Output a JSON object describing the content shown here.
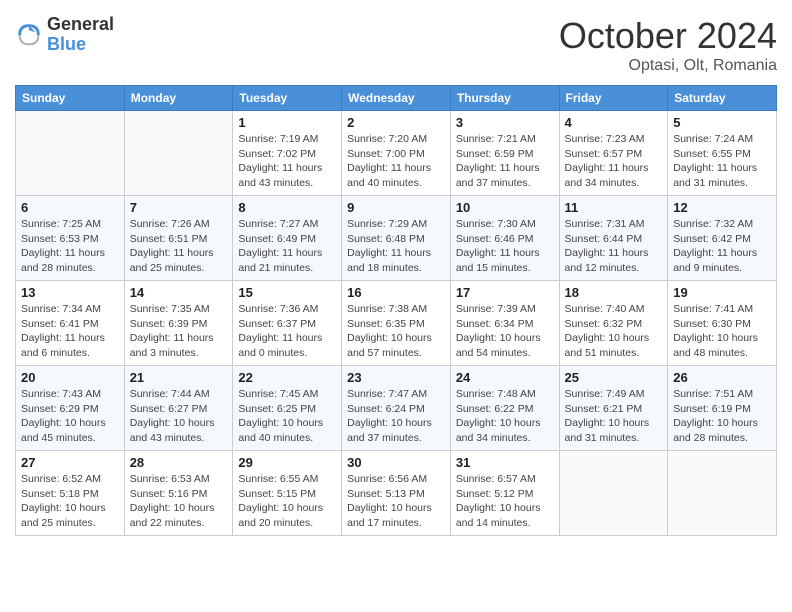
{
  "header": {
    "logo_line1": "General",
    "logo_line2": "Blue",
    "month": "October 2024",
    "location": "Optasi, Olt, Romania"
  },
  "weekdays": [
    "Sunday",
    "Monday",
    "Tuesday",
    "Wednesday",
    "Thursday",
    "Friday",
    "Saturday"
  ],
  "weeks": [
    [
      {
        "day": "",
        "empty": true
      },
      {
        "day": "",
        "empty": true
      },
      {
        "day": "1",
        "sunrise": "Sunrise: 7:19 AM",
        "sunset": "Sunset: 7:02 PM",
        "daylight": "Daylight: 11 hours and 43 minutes."
      },
      {
        "day": "2",
        "sunrise": "Sunrise: 7:20 AM",
        "sunset": "Sunset: 7:00 PM",
        "daylight": "Daylight: 11 hours and 40 minutes."
      },
      {
        "day": "3",
        "sunrise": "Sunrise: 7:21 AM",
        "sunset": "Sunset: 6:59 PM",
        "daylight": "Daylight: 11 hours and 37 minutes."
      },
      {
        "day": "4",
        "sunrise": "Sunrise: 7:23 AM",
        "sunset": "Sunset: 6:57 PM",
        "daylight": "Daylight: 11 hours and 34 minutes."
      },
      {
        "day": "5",
        "sunrise": "Sunrise: 7:24 AM",
        "sunset": "Sunset: 6:55 PM",
        "daylight": "Daylight: 11 hours and 31 minutes."
      }
    ],
    [
      {
        "day": "6",
        "sunrise": "Sunrise: 7:25 AM",
        "sunset": "Sunset: 6:53 PM",
        "daylight": "Daylight: 11 hours and 28 minutes."
      },
      {
        "day": "7",
        "sunrise": "Sunrise: 7:26 AM",
        "sunset": "Sunset: 6:51 PM",
        "daylight": "Daylight: 11 hours and 25 minutes."
      },
      {
        "day": "8",
        "sunrise": "Sunrise: 7:27 AM",
        "sunset": "Sunset: 6:49 PM",
        "daylight": "Daylight: 11 hours and 21 minutes."
      },
      {
        "day": "9",
        "sunrise": "Sunrise: 7:29 AM",
        "sunset": "Sunset: 6:48 PM",
        "daylight": "Daylight: 11 hours and 18 minutes."
      },
      {
        "day": "10",
        "sunrise": "Sunrise: 7:30 AM",
        "sunset": "Sunset: 6:46 PM",
        "daylight": "Daylight: 11 hours and 15 minutes."
      },
      {
        "day": "11",
        "sunrise": "Sunrise: 7:31 AM",
        "sunset": "Sunset: 6:44 PM",
        "daylight": "Daylight: 11 hours and 12 minutes."
      },
      {
        "day": "12",
        "sunrise": "Sunrise: 7:32 AM",
        "sunset": "Sunset: 6:42 PM",
        "daylight": "Daylight: 11 hours and 9 minutes."
      }
    ],
    [
      {
        "day": "13",
        "sunrise": "Sunrise: 7:34 AM",
        "sunset": "Sunset: 6:41 PM",
        "daylight": "Daylight: 11 hours and 6 minutes."
      },
      {
        "day": "14",
        "sunrise": "Sunrise: 7:35 AM",
        "sunset": "Sunset: 6:39 PM",
        "daylight": "Daylight: 11 hours and 3 minutes."
      },
      {
        "day": "15",
        "sunrise": "Sunrise: 7:36 AM",
        "sunset": "Sunset: 6:37 PM",
        "daylight": "Daylight: 11 hours and 0 minutes."
      },
      {
        "day": "16",
        "sunrise": "Sunrise: 7:38 AM",
        "sunset": "Sunset: 6:35 PM",
        "daylight": "Daylight: 10 hours and 57 minutes."
      },
      {
        "day": "17",
        "sunrise": "Sunrise: 7:39 AM",
        "sunset": "Sunset: 6:34 PM",
        "daylight": "Daylight: 10 hours and 54 minutes."
      },
      {
        "day": "18",
        "sunrise": "Sunrise: 7:40 AM",
        "sunset": "Sunset: 6:32 PM",
        "daylight": "Daylight: 10 hours and 51 minutes."
      },
      {
        "day": "19",
        "sunrise": "Sunrise: 7:41 AM",
        "sunset": "Sunset: 6:30 PM",
        "daylight": "Daylight: 10 hours and 48 minutes."
      }
    ],
    [
      {
        "day": "20",
        "sunrise": "Sunrise: 7:43 AM",
        "sunset": "Sunset: 6:29 PM",
        "daylight": "Daylight: 10 hours and 45 minutes."
      },
      {
        "day": "21",
        "sunrise": "Sunrise: 7:44 AM",
        "sunset": "Sunset: 6:27 PM",
        "daylight": "Daylight: 10 hours and 43 minutes."
      },
      {
        "day": "22",
        "sunrise": "Sunrise: 7:45 AM",
        "sunset": "Sunset: 6:25 PM",
        "daylight": "Daylight: 10 hours and 40 minutes."
      },
      {
        "day": "23",
        "sunrise": "Sunrise: 7:47 AM",
        "sunset": "Sunset: 6:24 PM",
        "daylight": "Daylight: 10 hours and 37 minutes."
      },
      {
        "day": "24",
        "sunrise": "Sunrise: 7:48 AM",
        "sunset": "Sunset: 6:22 PM",
        "daylight": "Daylight: 10 hours and 34 minutes."
      },
      {
        "day": "25",
        "sunrise": "Sunrise: 7:49 AM",
        "sunset": "Sunset: 6:21 PM",
        "daylight": "Daylight: 10 hours and 31 minutes."
      },
      {
        "day": "26",
        "sunrise": "Sunrise: 7:51 AM",
        "sunset": "Sunset: 6:19 PM",
        "daylight": "Daylight: 10 hours and 28 minutes."
      }
    ],
    [
      {
        "day": "27",
        "sunrise": "Sunrise: 6:52 AM",
        "sunset": "Sunset: 5:18 PM",
        "daylight": "Daylight: 10 hours and 25 minutes."
      },
      {
        "day": "28",
        "sunrise": "Sunrise: 6:53 AM",
        "sunset": "Sunset: 5:16 PM",
        "daylight": "Daylight: 10 hours and 22 minutes."
      },
      {
        "day": "29",
        "sunrise": "Sunrise: 6:55 AM",
        "sunset": "Sunset: 5:15 PM",
        "daylight": "Daylight: 10 hours and 20 minutes."
      },
      {
        "day": "30",
        "sunrise": "Sunrise: 6:56 AM",
        "sunset": "Sunset: 5:13 PM",
        "daylight": "Daylight: 10 hours and 17 minutes."
      },
      {
        "day": "31",
        "sunrise": "Sunrise: 6:57 AM",
        "sunset": "Sunset: 5:12 PM",
        "daylight": "Daylight: 10 hours and 14 minutes."
      },
      {
        "day": "",
        "empty": true
      },
      {
        "day": "",
        "empty": true
      }
    ]
  ]
}
